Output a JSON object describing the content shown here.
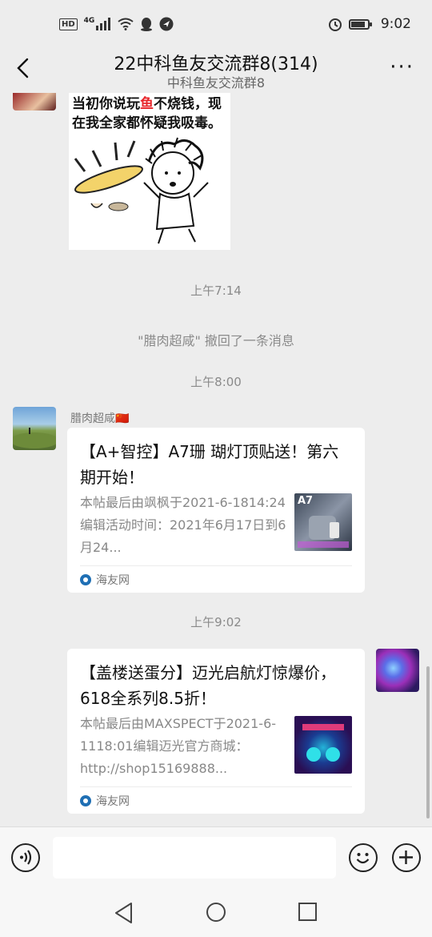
{
  "status_bar": {
    "hd": "HD",
    "network": "4G",
    "time": "9:02",
    "icons": [
      "hd-icon",
      "signal-icon",
      "wifi-icon",
      "qq-icon",
      "navigation-icon",
      "alarm-icon",
      "battery-icon"
    ]
  },
  "header": {
    "title": "22中科鱼友交流群8(314)",
    "subtitle": "中科鱼友交流群8",
    "more": "···"
  },
  "sticker": {
    "line1_a": "当初你说玩",
    "line1_fish": "鱼",
    "line1_b": "不烧钱，现",
    "line2": "在我全家都怀疑我吸毒。"
  },
  "messages": {
    "time1": "上午7:14",
    "recall_notice": "\"腊肉超咸\" 撤回了一条消息",
    "time2": "上午8:00",
    "sender1": "腊肉超咸🇨🇳",
    "card1": {
      "title": "【A+智控】A7珊 瑚灯顶贴送！第六期开始！",
      "desc": "本帖最后由飒枫于2021-6-1814:24编辑活动时间：2021年6月17日到6月24...",
      "thumb_label": "A7",
      "source": "海友网"
    },
    "time3": "上午9:02",
    "card2": {
      "title": "【盖楼送蛋分】迈光启航灯惊爆价，618全系列8.5折！",
      "desc": "本帖最后由MAXSPECT于2021-6-1118:01编辑迈光官方商城：http://shop15169888...",
      "source": "海友网"
    }
  },
  "input": {
    "placeholder": ""
  }
}
